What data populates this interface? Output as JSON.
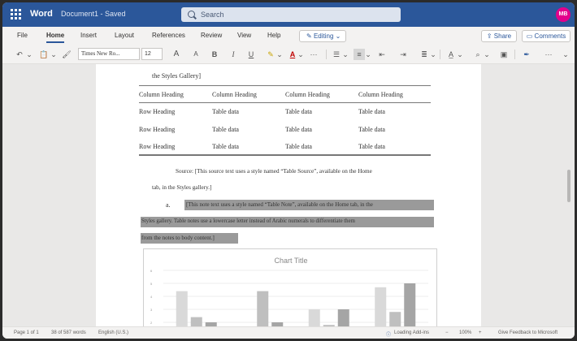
{
  "titlebar": {
    "app_name": "Word",
    "doc_name": "Document1 - Saved",
    "search_placeholder": "Search",
    "avatar_initials": "MB"
  },
  "menu": {
    "tabs": [
      "File",
      "Home",
      "Insert",
      "Layout",
      "References",
      "Review",
      "View",
      "Help"
    ],
    "active_tab": "Home",
    "editing_label": "Editing",
    "share_label": "Share",
    "comments_label": "Comments"
  },
  "toolbar": {
    "font_name": "Times New Ro...",
    "font_size": "12",
    "grow_font": "A",
    "shrink_font": "A",
    "bold": "B",
    "italic": "I",
    "underline": "U",
    "more": "···"
  },
  "document": {
    "gallery_tail": "the Styles Gallery]",
    "table": {
      "headers": [
        "Column Heading",
        "Column Heading",
        "Column Heading",
        "Column Heading"
      ],
      "rows": [
        [
          "Row Heading",
          "Table data",
          "Table data",
          "Table data"
        ],
        [
          "Row Heading",
          "Table data",
          "Table data",
          "Table data"
        ],
        [
          "Row Heading",
          "Table data",
          "Table data",
          "Table data"
        ]
      ]
    },
    "source_line1": "Source: [This source text uses a style named “Table Source”, available on the Home",
    "source_line2": "tab, in the Styles gallery.]",
    "note_marker": "a.",
    "note_line1": "[This note text uses a style named “Table Note”, available on the Home tab, in the",
    "note_line2": "Styles gallery. Table notes use a lowercase letter instead of Arabic numerals to differentiate them",
    "note_line3": "from the notes to body content.]"
  },
  "chart_data": {
    "type": "bar",
    "title": "Chart Title",
    "ytick_labels": [
      "6",
      "5",
      "4",
      "3",
      "2",
      "1"
    ],
    "ylim": [
      0,
      6
    ],
    "categories": [
      "",
      "",
      "",
      ""
    ],
    "series": [
      {
        "color": "#d9d9d9",
        "values": [
          4.4,
          1.2,
          3.0,
          4.7
        ]
      },
      {
        "color": "#bfbfbf",
        "values": [
          2.4,
          4.4,
          1.8,
          2.8
        ]
      },
      {
        "color": "#a5a5a5",
        "values": [
          2.0,
          2.0,
          3.0,
          5.0
        ]
      }
    ]
  },
  "status": {
    "page": "Page 1 of 1",
    "words": "38 of 587 words",
    "language": "English (U.S.)",
    "addins": "Loading Add-ins",
    "zoom": "100%",
    "feedback": "Give Feedback to Microsoft"
  }
}
